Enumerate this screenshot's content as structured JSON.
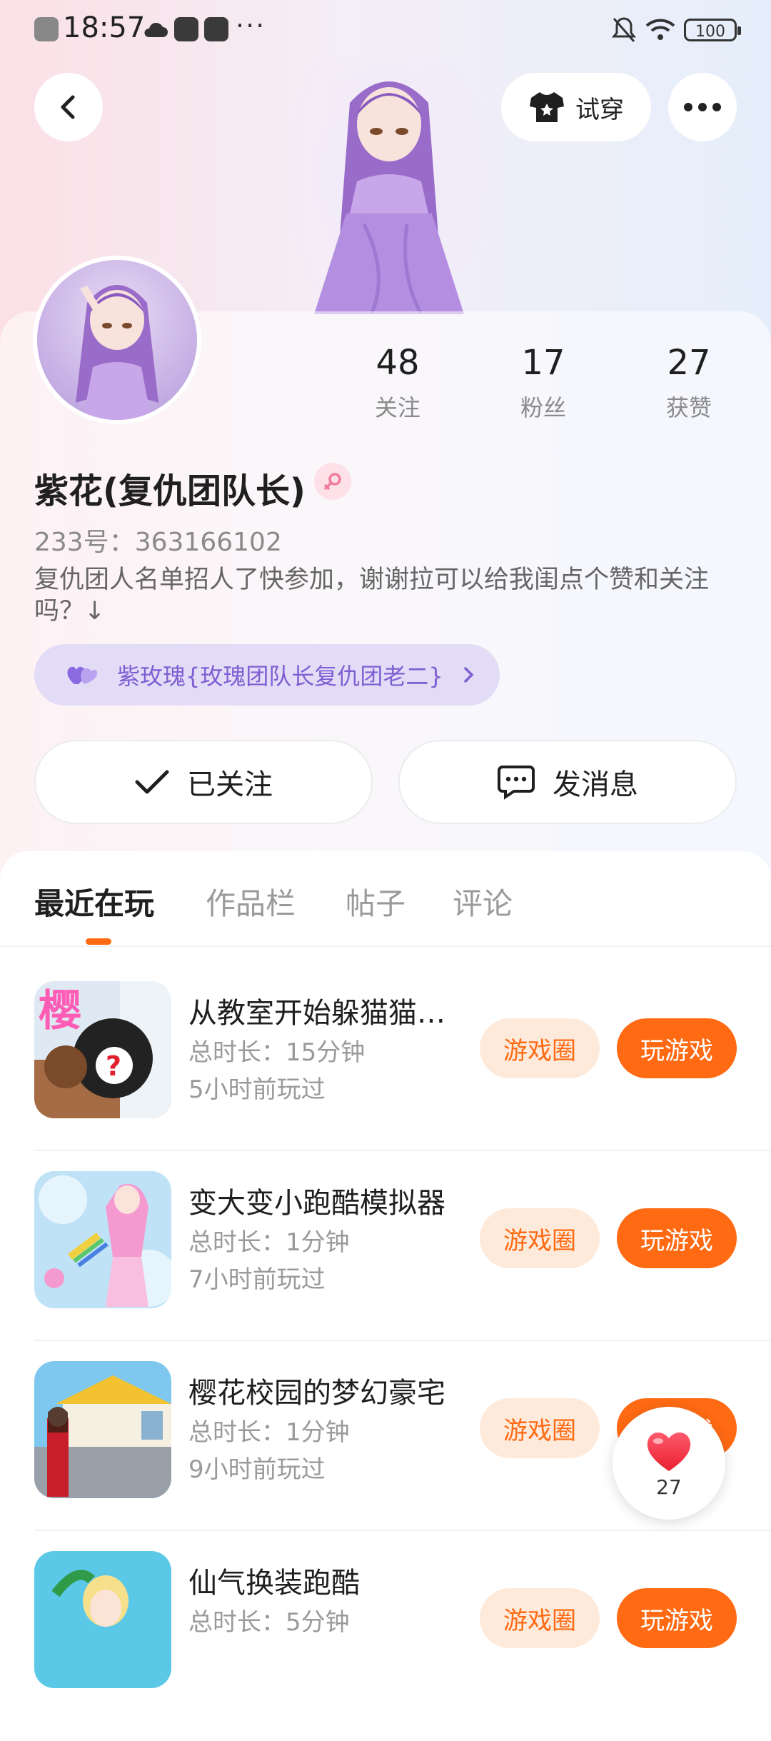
{
  "status_bar": {
    "time": "18:57",
    "battery": "100"
  },
  "header": {
    "try_on_label": "试穿"
  },
  "profile": {
    "name": "紫花(复仇团队长)",
    "uid_line": "233号：363166102",
    "bio": "复仇团人名单招人了快参加，谢谢拉可以给我闺点个赞和关注吗？↓",
    "relation_label": "紫玫瑰{玫瑰团队长复仇团老二}",
    "stats": [
      {
        "num": "48",
        "label": "关注"
      },
      {
        "num": "17",
        "label": "粉丝"
      },
      {
        "num": "27",
        "label": "获赞"
      }
    ]
  },
  "actions": {
    "follow_label": "已关注",
    "message_label": "发消息"
  },
  "tabs": [
    "最近在玩",
    "作品栏",
    "帖子",
    "评论"
  ],
  "games": [
    {
      "title": "从教室开始躲猫猫…",
      "duration": "总时长：15分钟",
      "last_played": "5小时前玩过",
      "thumb_text": "樱"
    },
    {
      "title": "变大变小跑酷模拟器",
      "duration": "总时长：1分钟",
      "last_played": "7小时前玩过",
      "thumb_text": ""
    },
    {
      "title": "樱花校园的梦幻豪宅",
      "duration": "总时长：1分钟",
      "last_played": "9小时前玩过",
      "thumb_text": ""
    },
    {
      "title": "仙气换装跑酷",
      "duration": "总时长：5分钟",
      "last_played": "",
      "thumb_text": ""
    }
  ],
  "game_circle_label": "游戏圈",
  "play_label": "玩游戏",
  "like_fab": {
    "count": "27"
  },
  "colors": {
    "accent": "#ff6a13",
    "accent_light": "#feeadb",
    "relation_bg": "#e3dcf6",
    "relation_text": "#7e5fd2"
  },
  "icons": [
    "back-arrow-icon",
    "shirt-icon",
    "more-icon",
    "gender-female-icon",
    "heart-icon",
    "chevron-right-icon",
    "check-icon",
    "chat-icon"
  ]
}
